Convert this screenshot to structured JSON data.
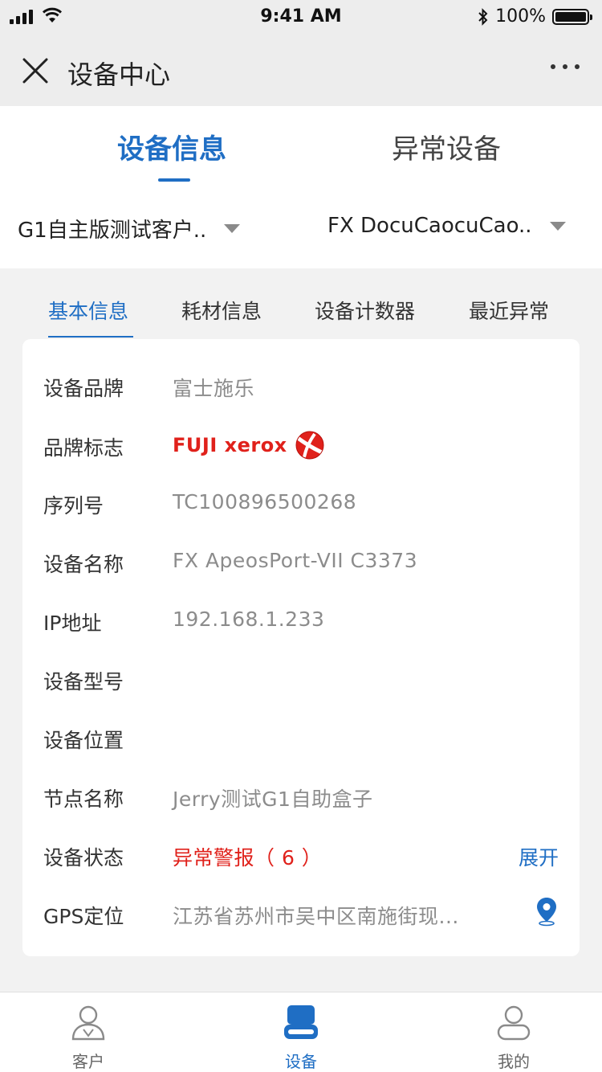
{
  "status_bar": {
    "time": "9:41 AM",
    "battery": "100%"
  },
  "navbar": {
    "title": "设备中心"
  },
  "main_tabs": [
    {
      "label": "设备信息",
      "active": true
    },
    {
      "label": "异常设备",
      "active": false
    }
  ],
  "filters": {
    "customer": "G1自主版测试客户..",
    "device": "FX DocuCaocuCao.."
  },
  "sub_tabs": [
    {
      "label": "基本信息",
      "active": true
    },
    {
      "label": "耗材信息",
      "active": false
    },
    {
      "label": "设备计数器",
      "active": false
    },
    {
      "label": "最近异常",
      "active": false
    }
  ],
  "info": {
    "brand_label": "设备品牌",
    "brand_value": "富士施乐",
    "logo_label": "品牌标志",
    "logo_text": "FUJI xerox",
    "serial_label": "序列号",
    "serial_value": "TC100896500268",
    "name_label": "设备名称",
    "name_value": "FX ApeosPort-VII C3373",
    "ip_label": "IP地址",
    "ip_value": "192.168.1.233",
    "model_label": "设备型号",
    "model_value": "",
    "location_label": "设备位置",
    "location_value": "",
    "node_label": "节点名称",
    "node_value": "Jerry测试G1自助盒子",
    "status_label": "设备状态",
    "status_value": "异常警报（ 6 ）",
    "status_action": "展开",
    "gps_label": "GPS定位",
    "gps_value": "江苏省苏州市吴中区南施街现..."
  },
  "tab_bar": [
    {
      "label": "客户",
      "icon": "user-icon",
      "active": false
    },
    {
      "label": "设备",
      "icon": "device-icon",
      "active": true
    },
    {
      "label": "我的",
      "icon": "profile-icon",
      "active": false
    }
  ],
  "colors": {
    "accent": "#1f6ec4",
    "alert": "#e0211b",
    "background": "#f2f2f2"
  }
}
